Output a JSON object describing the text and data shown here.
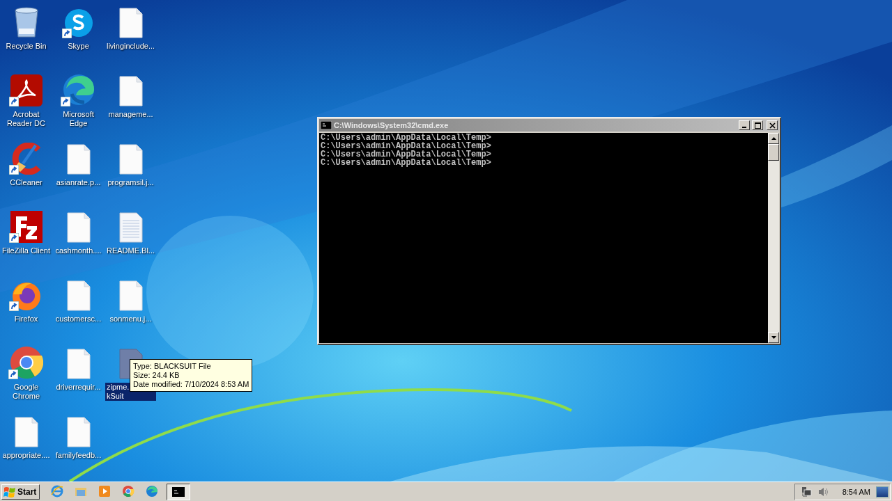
{
  "desktop_icons": [
    {
      "label": "Recycle Bin",
      "kind": "recycle",
      "shortcut": false,
      "selected": false
    },
    {
      "label": "Acrobat Reader DC",
      "kind": "acrobat",
      "shortcut": true,
      "selected": false
    },
    {
      "label": "CCleaner",
      "kind": "ccleaner",
      "shortcut": true,
      "selected": false
    },
    {
      "label": "FileZilla Client",
      "kind": "filezilla",
      "shortcut": true,
      "selected": false
    },
    {
      "label": "Firefox",
      "kind": "firefox",
      "shortcut": true,
      "selected": false
    },
    {
      "label": "Google Chrome",
      "kind": "chrome",
      "shortcut": true,
      "selected": false
    },
    {
      "label": "appropriate....",
      "kind": "file",
      "shortcut": false,
      "selected": false
    },
    {
      "label": "Skype",
      "kind": "skype",
      "shortcut": true,
      "selected": false
    },
    {
      "label": "Microsoft Edge",
      "kind": "edge",
      "shortcut": true,
      "selected": false
    },
    {
      "label": "asianrate.p...",
      "kind": "file",
      "shortcut": false,
      "selected": false
    },
    {
      "label": "cashmonth....",
      "kind": "file",
      "shortcut": false,
      "selected": false
    },
    {
      "label": "customersc...",
      "kind": "file",
      "shortcut": false,
      "selected": false
    },
    {
      "label": "driverrequir...",
      "kind": "file",
      "shortcut": false,
      "selected": false
    },
    {
      "label": "familyfeedb...",
      "kind": "file",
      "shortcut": false,
      "selected": false
    },
    {
      "label": "livinginclude...",
      "kind": "file",
      "shortcut": false,
      "selected": false
    },
    {
      "label": "manageme...",
      "kind": "file",
      "shortcut": false,
      "selected": false
    },
    {
      "label": "programsil.j...",
      "kind": "file",
      "shortcut": false,
      "selected": false
    },
    {
      "label": "README.Bl...",
      "kind": "textfile",
      "shortcut": false,
      "selected": false
    },
    {
      "label": "sonmenu.j...",
      "kind": "file",
      "shortcut": false,
      "selected": false
    },
    {
      "label": "zipme.\nkSuit",
      "kind": "darkfile",
      "shortcut": false,
      "selected": true
    }
  ],
  "tooltip": {
    "lines": [
      "Type: BLACKSUIT File",
      "Size: 24.4 KB",
      "Date modified: 7/10/2024 8:53 AM"
    ]
  },
  "console_window": {
    "title": "C:\\Windows\\System32\\cmd.exe",
    "active": false,
    "lines": [
      "C:\\Users\\admin\\AppData\\Local\\Temp>",
      "C:\\Users\\admin\\AppData\\Local\\Temp>",
      "C:\\Users\\admin\\AppData\\Local\\Temp>",
      "C:\\Users\\admin\\AppData\\Local\\Temp>"
    ]
  },
  "taskbar": {
    "start_label": "Start",
    "items": [
      {
        "kind": "ie",
        "active": false
      },
      {
        "kind": "explorer",
        "active": false
      },
      {
        "kind": "media",
        "active": false
      },
      {
        "kind": "chrome",
        "active": false
      },
      {
        "kind": "edge",
        "active": false
      },
      {
        "kind": "cmd",
        "active": true
      }
    ],
    "clock": "8:54 AM"
  }
}
